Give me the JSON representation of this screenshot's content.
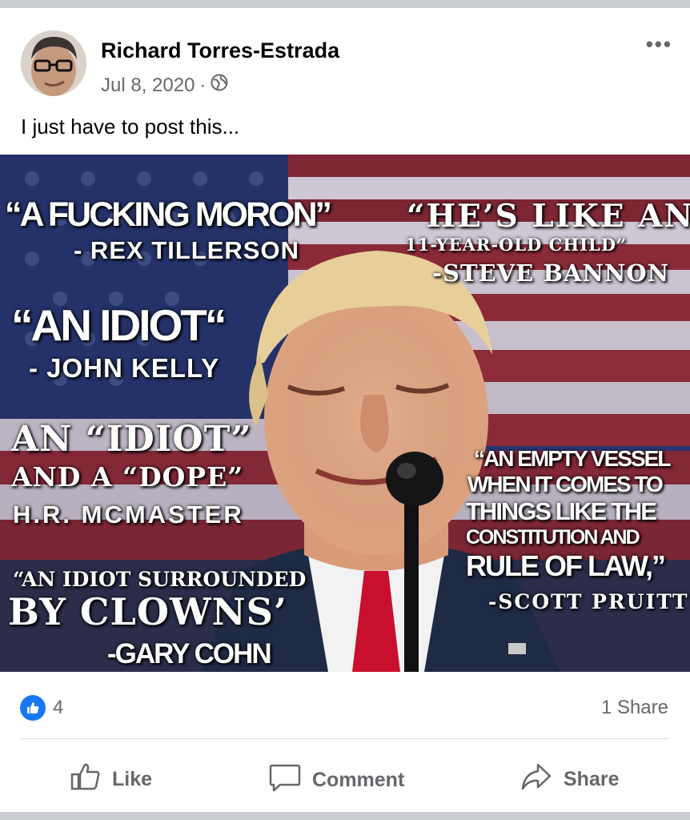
{
  "post": {
    "author": "Richard Torres-Estrada",
    "date": "Jul 8, 2020",
    "separator": "·",
    "privacy_icon": "globe-icon",
    "more_icon": "more-options-icon",
    "more_label": "•••",
    "text": "I just have to post this..."
  },
  "image": {
    "quotes": [
      {
        "text": "“A FUCKING MORON”"
      },
      {
        "text": "- REX TILLERSON"
      },
      {
        "text": "“HE’S LIKE AN"
      },
      {
        "text": "11-YEAR-OLD CHILD”"
      },
      {
        "text": "-STEVE BANNON"
      },
      {
        "text": "“AN IDIOT“"
      },
      {
        "text": "- JOHN KELLY"
      },
      {
        "text": "AN “IDIOT”"
      },
      {
        "text": "AND A “DOPE”"
      },
      {
        "text": "H.R. MCMASTER"
      },
      {
        "text": "“AN EMPTY VESSEL"
      },
      {
        "text": "WHEN IT COMES TO"
      },
      {
        "text": "THINGS LIKE THE"
      },
      {
        "text": "CONSTITUTION AND"
      },
      {
        "text": "RULE OF LAW,”"
      },
      {
        "text": "-SCOTT PRUITT"
      },
      {
        "text": "“AN IDIOT SURROUNDED"
      },
      {
        "text": "BY CLOWNS’"
      },
      {
        "text": "-GARY COHN"
      }
    ]
  },
  "stats": {
    "reactions_icon": "like-reaction-icon",
    "reaction_count": "4",
    "shares": "1 Share"
  },
  "actions": {
    "like": "Like",
    "comment": "Comment",
    "share": "Share"
  },
  "colors": {
    "facebook_blue": "#1877f2",
    "secondary_text": "#65676b"
  }
}
